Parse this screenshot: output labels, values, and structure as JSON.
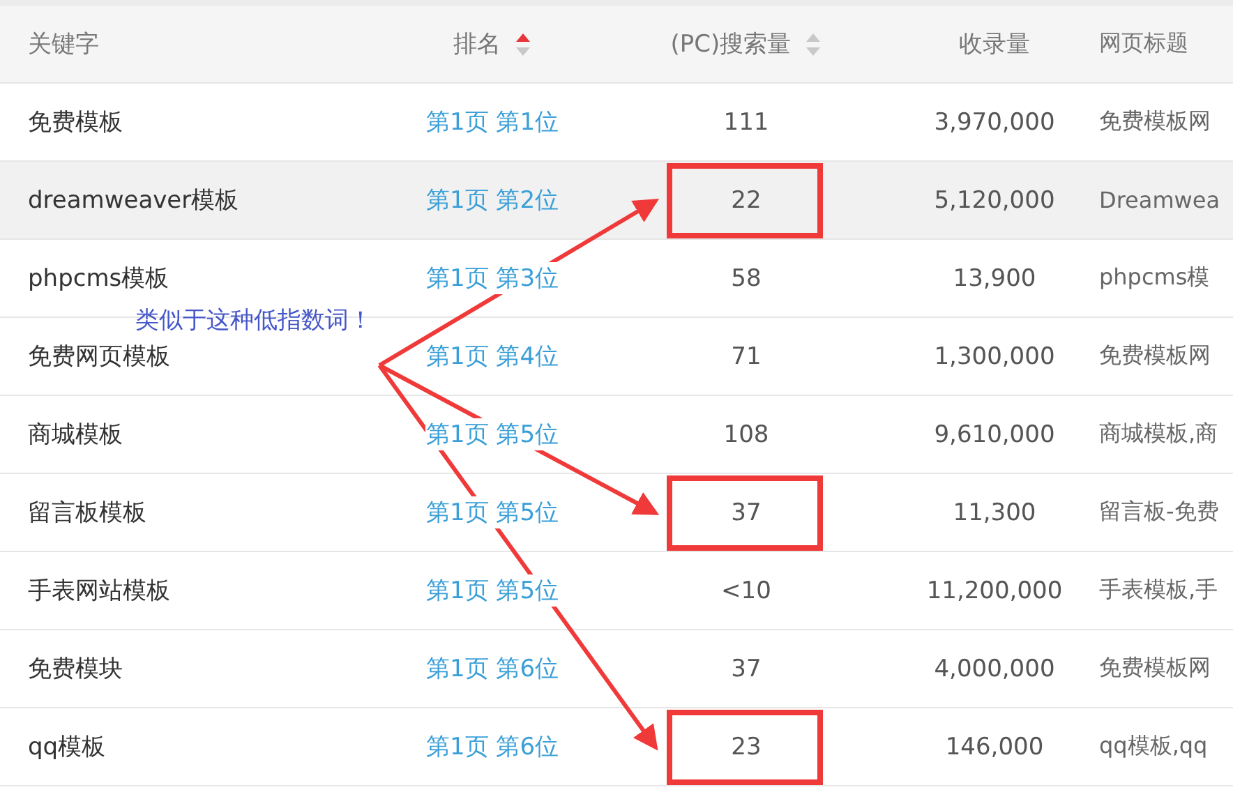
{
  "table": {
    "columns": [
      {
        "label": "关键字",
        "sortable": false
      },
      {
        "label": "排名",
        "sortable": true,
        "sorted": true
      },
      {
        "label": "(PC)搜索量",
        "sortable": true,
        "sorted": false
      },
      {
        "label": "收录量",
        "sortable": false
      },
      {
        "label": "网页标题",
        "sortable": false
      }
    ],
    "rows": [
      {
        "keyword": "免费模板",
        "rank": "第1页 第1位",
        "volume": "111",
        "indexed": "3,970,000",
        "title": "免费模板网",
        "highlighted": false,
        "marked": false
      },
      {
        "keyword": "dreamweaver模板",
        "rank": "第1页 第2位",
        "volume": "22",
        "indexed": "5,120,000",
        "title": "Dreamwea",
        "highlighted": true,
        "marked": true
      },
      {
        "keyword": "phpcms模板",
        "rank": "第1页 第3位",
        "volume": "58",
        "indexed": "13,900",
        "title": "phpcms模",
        "highlighted": false,
        "marked": false
      },
      {
        "keyword": "免费网页模板",
        "rank": "第1页 第4位",
        "volume": "71",
        "indexed": "1,300,000",
        "title": "免费模板网",
        "highlighted": false,
        "marked": false
      },
      {
        "keyword": "商城模板",
        "rank": "第1页 第5位",
        "volume": "108",
        "indexed": "9,610,000",
        "title": "商城模板,商",
        "highlighted": false,
        "marked": false
      },
      {
        "keyword": "留言板模板",
        "rank": "第1页 第5位",
        "volume": "37",
        "indexed": "11,300",
        "title": "留言板-免费",
        "highlighted": false,
        "marked": true
      },
      {
        "keyword": "手表网站模板",
        "rank": "第1页 第5位",
        "volume": "<10",
        "indexed": "11,200,000",
        "title": "手表模板,手",
        "highlighted": false,
        "marked": false
      },
      {
        "keyword": "免费模块",
        "rank": "第1页 第6位",
        "volume": "37",
        "indexed": "4,000,000",
        "title": "免费模板网",
        "highlighted": false,
        "marked": false
      },
      {
        "keyword": "qq模板",
        "rank": "第1页 第6位",
        "volume": "23",
        "indexed": "146,000",
        "title": "qq模板,qq",
        "highlighted": false,
        "marked": true
      }
    ]
  },
  "annotation": {
    "text": "类似于这种低指数词！"
  }
}
